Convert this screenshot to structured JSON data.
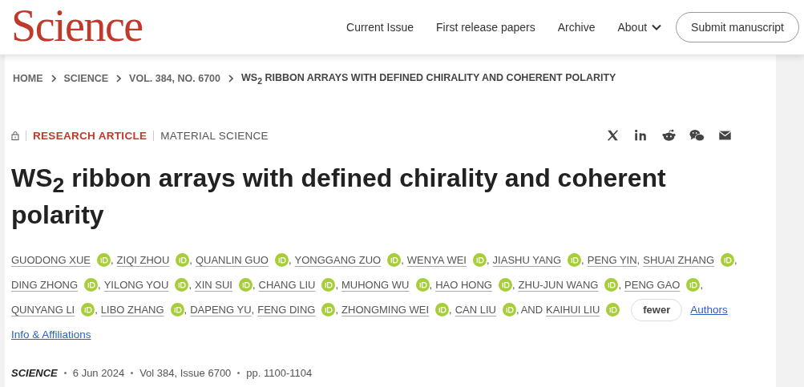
{
  "header": {
    "logo": "Science",
    "nav": [
      {
        "label": "Current Issue",
        "kind": "link"
      },
      {
        "label": "First release papers",
        "kind": "link"
      },
      {
        "label": "Archive",
        "kind": "link"
      },
      {
        "label": "About",
        "kind": "dropdown"
      }
    ],
    "submit_button": "Submit manuscript"
  },
  "breadcrumb": [
    "HOME",
    "SCIENCE",
    "VOL. 384, NO. 6700",
    "WS$_{2}$ RIBBON ARRAYS WITH DEFINED CHIRALITY AND COHERENT POLARITY"
  ],
  "article": {
    "locked": true,
    "type": "RESEARCH ARTICLE",
    "subject": "MATERIAL SCIENCE",
    "share": [
      {
        "kind": "x"
      },
      {
        "kind": "linkedin"
      },
      {
        "kind": "reddit"
      },
      {
        "kind": "wechat"
      },
      {
        "kind": "email"
      }
    ],
    "title": "WS$_{2}$ ribbon arrays with defined chirality and coherent polarity",
    "author_separator": ",",
    "conjunction": "AND",
    "author_lines": [
      [
        {
          "name": "GUODONG XUE",
          "orcid": true
        },
        {
          "name": "ZIQI ZHOU",
          "orcid": true
        },
        {
          "name": "QUANLIN GUO",
          "orcid": true
        },
        {
          "name": "YONGGANG ZUO",
          "orcid": true
        },
        {
          "name": "WENYA WEI",
          "orcid": true
        },
        {
          "name": "JIASHU YANG",
          "orcid": true
        },
        {
          "name": "PENG YIN",
          "orcid": false
        },
        {
          "name": "SHUAI ZHANG",
          "orcid": true
        }
      ],
      [
        {
          "name": "DING ZHONG",
          "orcid": true
        },
        {
          "name": "YILONG YOU",
          "orcid": true
        },
        {
          "name": "XIN SUI",
          "orcid": true
        },
        {
          "name": "CHANG LIU",
          "orcid": true
        },
        {
          "name": "MUHONG WU",
          "orcid": true
        },
        {
          "name": "HAO HONG",
          "orcid": true
        },
        {
          "name": "ZHU-JUN WANG",
          "orcid": true
        },
        {
          "name": "PENG GAO",
          "orcid": true
        }
      ],
      [
        {
          "name": "QUNYANG LI",
          "orcid": true
        },
        {
          "name": "LIBO ZHANG",
          "orcid": true
        },
        {
          "name": "DAPENG YU",
          "orcid": false
        },
        {
          "name": "FENG DING",
          "orcid": true
        },
        {
          "name": "ZHONGMING WEI",
          "orcid": true
        },
        {
          "name": "CAN LIU",
          "orcid": true
        },
        {
          "name": "KAIHUI LIU",
          "orcid": true
        }
      ]
    ],
    "fewer_button": "fewer",
    "authors_link": "Authors",
    "info_link": "Info & Affiliations",
    "journal": "SCIENCE",
    "date": "6 Jun 2024",
    "volume": "Vol 384, Issue 6700",
    "pages": "pp. 1100-1104"
  }
}
